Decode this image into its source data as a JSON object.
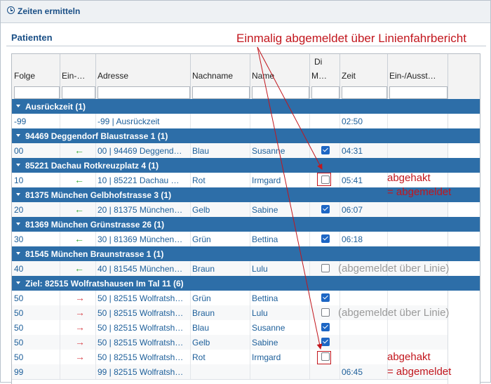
{
  "window": {
    "title": "Zeiten ermitteln"
  },
  "section": {
    "title": "Patienten"
  },
  "grid": {
    "group_header": "Di",
    "columns": [
      "Folge",
      "Ein-…",
      "Adresse",
      "Nachname",
      "Name",
      "M…",
      "Zeit",
      "Ein-/Ausst…"
    ],
    "groups": [
      {
        "label": "Ausrückzeit (1)",
        "rows": [
          {
            "folge": "-99",
            "dir": "",
            "adresse": "-99 | Ausrückzeit",
            "nachname": "",
            "name": "",
            "check": "",
            "zeit": "02:50"
          }
        ]
      },
      {
        "label": "94469 Deggendorf Blaustrasse 1 (1)",
        "rows": [
          {
            "folge": "00",
            "dir": "in",
            "adresse": "00 | 94469 Deggend…",
            "nachname": "Blau",
            "name": "Susanne",
            "check": "on",
            "zeit": "04:31"
          }
        ]
      },
      {
        "label": "85221 Dachau Rotkreuzplatz 4 (1)",
        "rows": [
          {
            "folge": "10",
            "dir": "in",
            "adresse": "10 | 85221 Dachau …",
            "nachname": "Rot",
            "name": "Irmgard",
            "check": "off",
            "zeit": "05:41"
          }
        ]
      },
      {
        "label": "81375 München Gelbhofstrasse 3 (1)",
        "rows": [
          {
            "folge": "20",
            "dir": "in",
            "adresse": "20 | 81375 München…",
            "nachname": "Gelb",
            "name": "Sabine",
            "check": "on",
            "zeit": "06:07"
          }
        ]
      },
      {
        "label": "81369 München Grünstrasse 26 (1)",
        "rows": [
          {
            "folge": "30",
            "dir": "in",
            "adresse": "30 | 81369 München…",
            "nachname": "Grün",
            "name": "Bettina",
            "check": "on",
            "zeit": "06:18"
          }
        ]
      },
      {
        "label": "81545 München Braunstrasse 1 (1)",
        "rows": [
          {
            "folge": "40",
            "dir": "in",
            "adresse": "40 | 81545 München…",
            "nachname": "Braun",
            "name": "Lulu",
            "check": "off",
            "zeit": ""
          }
        ]
      },
      {
        "label": "Ziel: 82515 Wolfratshausen Im Tal 11 (6)",
        "rows": [
          {
            "folge": "50",
            "dir": "out",
            "adresse": "50 | 82515 Wolfratsh…",
            "nachname": "Grün",
            "name": "Bettina",
            "check": "on",
            "zeit": ""
          },
          {
            "folge": "50",
            "dir": "out",
            "adresse": "50 | 82515 Wolfratsh…",
            "nachname": "Braun",
            "name": "Lulu",
            "check": "off",
            "zeit": ""
          },
          {
            "folge": "50",
            "dir": "out",
            "adresse": "50 | 82515 Wolfratsh…",
            "nachname": "Blau",
            "name": "Susanne",
            "check": "on",
            "zeit": ""
          },
          {
            "folge": "50",
            "dir": "out",
            "adresse": "50 | 82515 Wolfratsh…",
            "nachname": "Gelb",
            "name": "Sabine",
            "check": "on",
            "zeit": ""
          },
          {
            "folge": "50",
            "dir": "out",
            "adresse": "50 | 82515 Wolfratsh…",
            "nachname": "Rot",
            "name": "Irmgard",
            "check": "off",
            "zeit": ""
          },
          {
            "folge": "99",
            "dir": "",
            "adresse": "99 | 82515 Wolfratsh…",
            "nachname": "",
            "name": "",
            "check": "",
            "zeit": "06:45"
          }
        ]
      }
    ]
  },
  "annotations": {
    "top": "Einmalig abgemeldet über Linienfahrbericht",
    "checked_line1": "abgehakt",
    "checked_line2": "= abgemeldet",
    "via_line": "(abgemeldet über Linie)"
  },
  "icons": {
    "header": "clock-icon",
    "expand": "triangle-down-icon",
    "in": "arrow-left-icon",
    "out": "arrow-right-icon"
  },
  "colors": {
    "group_bg": "#2d6ea8",
    "link": "#1d5f9a",
    "annotation": "#c2161d",
    "arrow_in": "#3aa835",
    "arrow_out": "#d9454c"
  }
}
